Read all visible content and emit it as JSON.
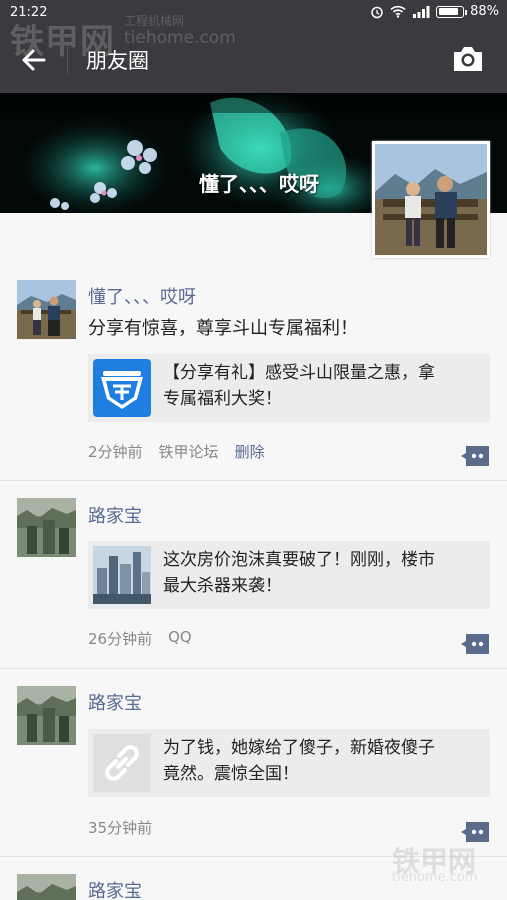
{
  "status_bar": {
    "time": "21:22",
    "battery": "88%",
    "battery_level": 0.88
  },
  "watermark": {
    "brand": "铁甲网",
    "sub": "工程机械网",
    "url": "tiehome.com"
  },
  "header": {
    "title": "朋友圈"
  },
  "cover": {
    "username": "懂了、、、哎呀"
  },
  "posts": [
    {
      "name": "懂了、、、哎呀",
      "text": "分享有惊喜，尊享斗山专属福利！",
      "link_line1": "【分享有礼】感受斗山限量之惠，拿",
      "link_line2": "专属福利大奖！",
      "time": "2分钟前",
      "source": "铁甲论坛",
      "delete": "删除"
    },
    {
      "name": "路家宝",
      "link_line1": "这次房价泡沫真要破了！刚刚，楼市",
      "link_line2": "最大杀器来袭！",
      "time": "26分钟前",
      "source": "QQ"
    },
    {
      "name": "路家宝",
      "link_line1": "为了钱，她嫁给了傻子，新婚夜傻子",
      "link_line2": "竟然。震惊全国！",
      "time": "35分钟前"
    },
    {
      "name": "路家宝"
    }
  ]
}
